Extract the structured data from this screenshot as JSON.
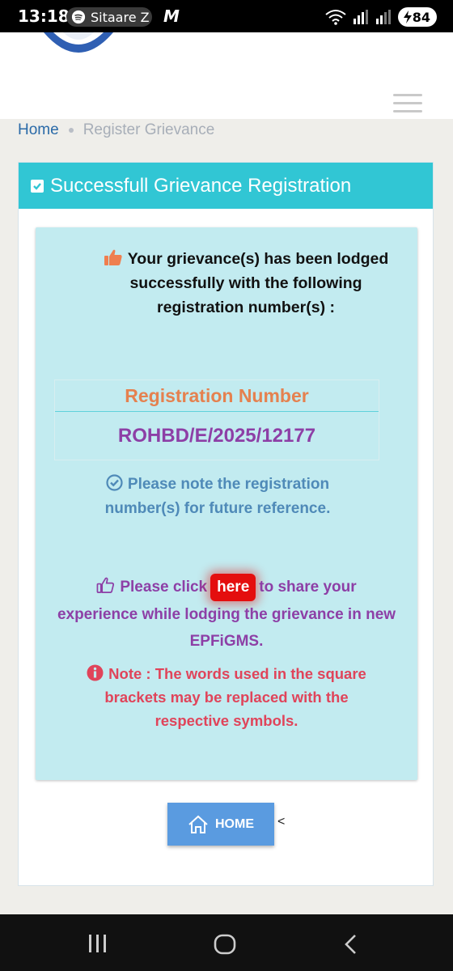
{
  "status_bar": {
    "time": "13:18",
    "media_label": "Sitaare Z",
    "app_letter": "M",
    "battery": "84"
  },
  "breadcrumb": {
    "home": "Home",
    "current": "Register Grievance"
  },
  "card": {
    "title": "Successfull Grievance Registration",
    "success_message": "Your grievance(s) has been lodged successfully with the following registration number(s) :",
    "registration": {
      "header": "Registration Number",
      "number": "ROHBD/E/2025/12177"
    },
    "note_reference": "Please note the registration number(s) for future reference.",
    "share": {
      "before": "Please click",
      "link": "here",
      "after": "to share your experience while lodging the grievance in new EPFiGMS."
    },
    "note_warning": "Note : The words used in the square brackets may be replaced with the respective symbols.",
    "home_button": "HOME",
    "trailing_mark": "<"
  },
  "colors": {
    "header_teal": "#31c6d4",
    "panel_bg": "#c2ebf0",
    "registration_header": "#e5814f",
    "registration_value": "#8d3fa6",
    "note_blue": "#4f8ab8",
    "warning_red": "#e0445a",
    "here_button": "#e40e0e",
    "home_button": "#5a9be0"
  },
  "icons": [
    "spotify-icon",
    "wifi-icon",
    "signal-icon",
    "battery-icon",
    "menu-icon",
    "checkbox-icon",
    "thumbs-up-icon",
    "check-circle-icon",
    "thumbs-up-outline-icon",
    "info-icon",
    "home-icon",
    "recent-apps-icon",
    "nav-home-icon",
    "nav-back-icon"
  ]
}
